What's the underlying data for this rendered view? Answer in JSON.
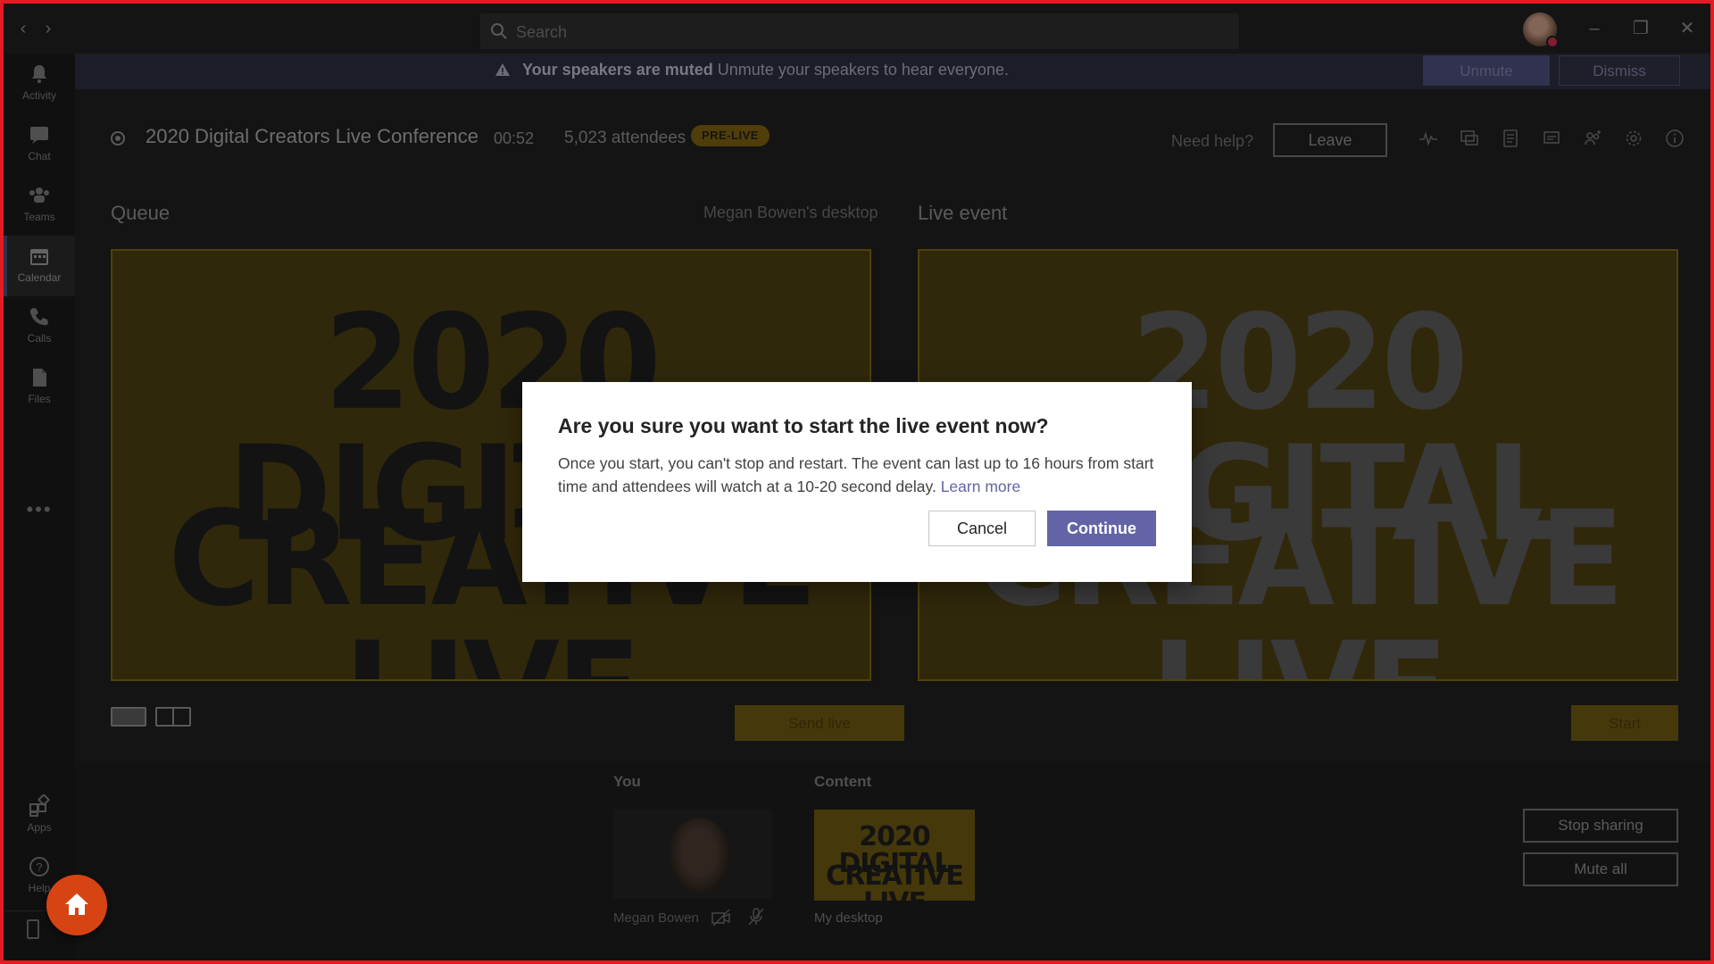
{
  "titlebar": {
    "search_placeholder": "Search",
    "back_icon": "chevron-left-icon",
    "forward_icon": "chevron-right-icon",
    "window_controls": [
      "minimize-icon",
      "restore-icon",
      "close-icon"
    ]
  },
  "rail": {
    "items": [
      {
        "label": "Activity",
        "icon": "bell-icon"
      },
      {
        "label": "Chat",
        "icon": "chat-icon"
      },
      {
        "label": "Teams",
        "icon": "teams-icon"
      },
      {
        "label": "Calendar",
        "icon": "calendar-icon",
        "active": true
      },
      {
        "label": "Calls",
        "icon": "phone-icon"
      },
      {
        "label": "Files",
        "icon": "files-icon"
      }
    ],
    "more": "•••",
    "bottom_items": [
      {
        "label": "Apps",
        "icon": "apps-icon"
      },
      {
        "label": "Help",
        "icon": "help-icon"
      }
    ]
  },
  "notification": {
    "bold": "Your speakers are muted",
    "text": "Unmute your speakers to hear everyone.",
    "unmute_label": "Unmute",
    "dismiss_label": "Dismiss"
  },
  "event": {
    "title": "2020 Digital Creators Live Conference",
    "timer": "00:52",
    "attendees": "5,023 attendees",
    "status": "PRE-LIVE",
    "need_help": "Need help?",
    "leave_label": "Leave",
    "toolbar_icons": [
      "health-icon",
      "qna-icon",
      "notes-icon",
      "chat-icon",
      "participants-icon",
      "settings-icon",
      "info-icon"
    ]
  },
  "queue": {
    "label": "Queue",
    "source": "Megan Bowen's desktop",
    "slide_line1": "2020 DIGITAL",
    "slide_line2": "CREATIVE LIVE",
    "send_live_label": "Send live"
  },
  "live": {
    "label": "Live event",
    "start_label": "Start"
  },
  "bottom": {
    "you_label": "You",
    "you_name": "Megan Bowen",
    "content_label": "Content",
    "content_name": "My desktop",
    "content_line1": "2020 DIGITAL",
    "content_line2": "CREATIVE LIVE",
    "stop_sharing_label": "Stop sharing",
    "mute_all_label": "Mute all"
  },
  "dialog": {
    "title": "Are you sure you want to start the live event now?",
    "body": "Once you start, you can't stop and restart. The event can last up to 16 hours from start time and attendees will watch at a 10-20 second delay.",
    "link": "Learn more",
    "cancel_label": "Cancel",
    "continue_label": "Continue"
  },
  "colors": {
    "accent": "#6264a7",
    "prelive_badge": "#7c6010",
    "slide_gold": "#6b5610",
    "frame_border": "#e31b23",
    "home_button": "#d64414"
  }
}
